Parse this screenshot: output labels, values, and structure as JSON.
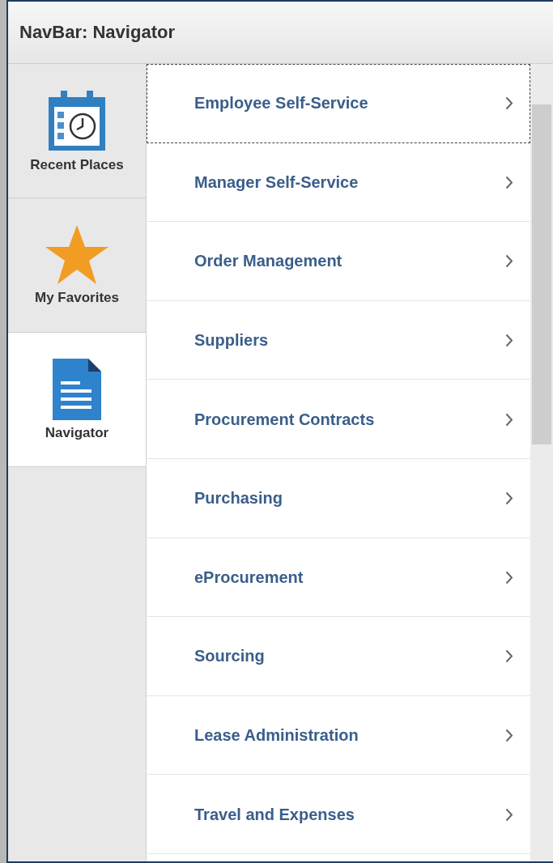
{
  "window": {
    "title": "NavBar: Navigator"
  },
  "sidebar": {
    "items": [
      {
        "label": "Recent Places",
        "kind": "calendar",
        "selected": false
      },
      {
        "label": "My Favorites",
        "kind": "star",
        "selected": false
      },
      {
        "label": "Navigator",
        "kind": "document",
        "selected": true
      }
    ]
  },
  "menu": {
    "items": [
      {
        "label": "Employee Self-Service",
        "focused": true
      },
      {
        "label": "Manager Self-Service",
        "focused": false
      },
      {
        "label": "Order Management",
        "focused": false
      },
      {
        "label": "Suppliers",
        "focused": false
      },
      {
        "label": "Procurement Contracts",
        "focused": false
      },
      {
        "label": "Purchasing",
        "focused": false
      },
      {
        "label": "eProcurement",
        "focused": false
      },
      {
        "label": "Sourcing",
        "focused": false
      },
      {
        "label": "Lease Administration",
        "focused": false
      },
      {
        "label": "Travel and Expenses",
        "focused": false
      }
    ]
  }
}
